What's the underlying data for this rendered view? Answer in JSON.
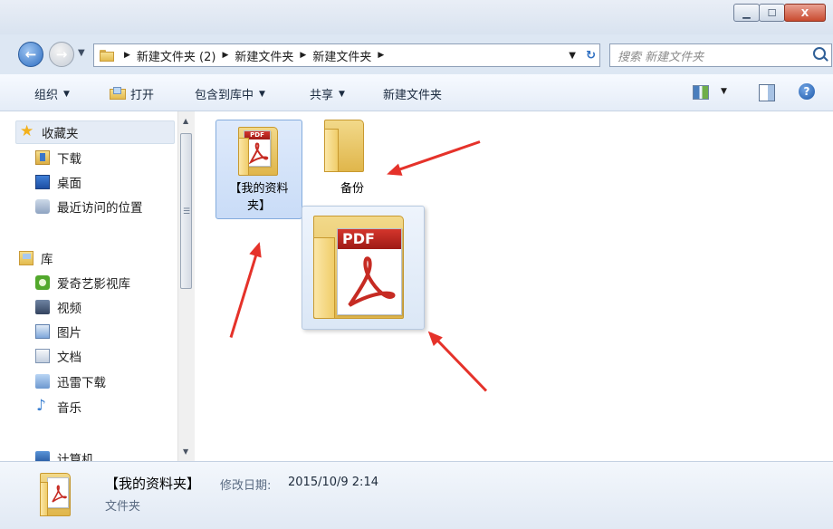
{
  "window": {
    "minimize_icon": "minimize-icon",
    "maximize_icon": "maximize-icon",
    "close_label": "X"
  },
  "address": {
    "crumbs": [
      "新建文件夹 (2)",
      "新建文件夹",
      "新建文件夹"
    ],
    "search_placeholder": "搜索 新建文件夹"
  },
  "toolbar": {
    "organize": "组织",
    "open": "打开",
    "include_in_library": "包含到库中",
    "share": "共享",
    "new_folder": "新建文件夹"
  },
  "sidebar": {
    "favorites": {
      "label": "收藏夹",
      "items": [
        "下载",
        "桌面",
        "最近访问的位置"
      ]
    },
    "libraries": {
      "label": "库",
      "items": [
        "爱奇艺影视库",
        "视频",
        "图片",
        "文档",
        "迅雷下载",
        "音乐"
      ]
    },
    "computer": {
      "label": "计算机"
    }
  },
  "files": [
    {
      "name_line1": "【我的资料",
      "name_line2": "夹】",
      "selected": true,
      "icon": "pdf-folder-icon"
    },
    {
      "name_line1": "备份",
      "name_line2": "",
      "selected": false,
      "icon": "folder-icon"
    }
  ],
  "drag_ghost": {
    "badge": "PDF"
  },
  "details": {
    "name": "【我的资料夹】",
    "modified_label": "修改日期:",
    "modified_value": "2015/10/9 2:14",
    "type": "文件夹"
  },
  "colors": {
    "annotation_arrow": "#e5322a",
    "selection": "#c9dcf7"
  }
}
